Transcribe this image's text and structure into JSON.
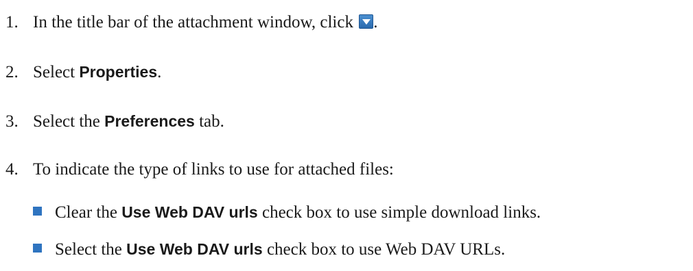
{
  "steps": [
    {
      "num": "1.",
      "pre": "In the title bar of the attachment window, click ",
      "icon": "dropdown-arrow-icon",
      "post": "."
    },
    {
      "num": "2.",
      "pre": "Select ",
      "bold": "Properties",
      "post": "."
    },
    {
      "num": "3.",
      "pre": "Select the ",
      "bold": "Preferences",
      "post": " tab."
    },
    {
      "num": "4.",
      "text": "To indicate the type of links to use for attached files:"
    }
  ],
  "bullets": [
    {
      "pre": "Clear the ",
      "bold": "Use Web DAV urls",
      "post": " check box to use simple download links."
    },
    {
      "pre": "Select the ",
      "bold": "Use Web DAV urls",
      "post": " check box to use Web DAV URLs."
    }
  ],
  "colors": {
    "bullet": "#2f74c0",
    "icon": "#3a7cc0"
  }
}
